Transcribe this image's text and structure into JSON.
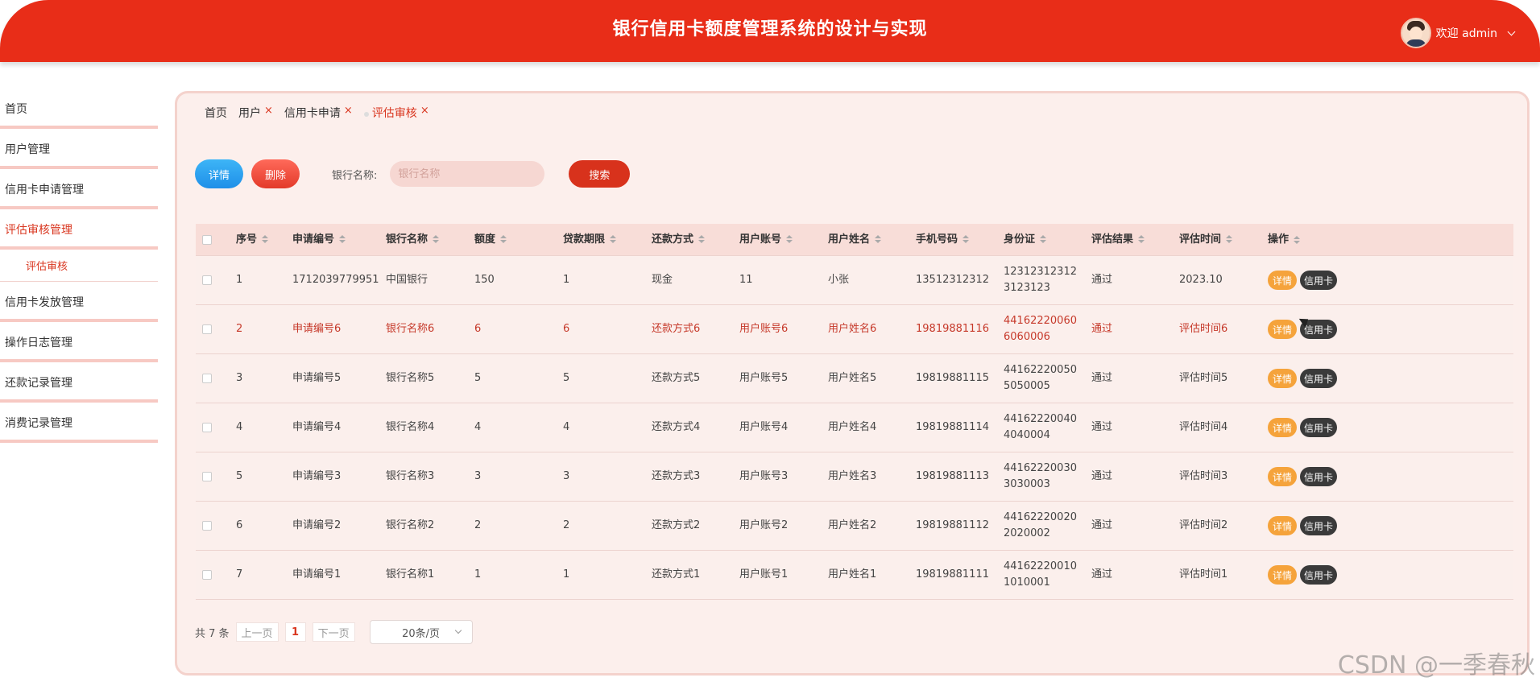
{
  "header": {
    "title": "银行信用卡额度管理系统的设计与实现",
    "welcome": "欢迎 admin"
  },
  "sidebar": {
    "items": [
      {
        "label": "首页"
      },
      {
        "label": "用户管理"
      },
      {
        "label": "信用卡申请管理"
      },
      {
        "label": "评估审核管理"
      },
      {
        "label": "信用卡发放管理"
      },
      {
        "label": "操作日志管理"
      },
      {
        "label": "还款记录管理"
      },
      {
        "label": "消费记录管理"
      }
    ],
    "sub_item": "评估审核"
  },
  "tabs": [
    {
      "label": "首页"
    },
    {
      "label": "用户",
      "close": "×"
    },
    {
      "label": "信用卡申请",
      "close": "×"
    },
    {
      "label": "评估审核",
      "close": "×"
    }
  ],
  "toolbar": {
    "detail": "详情",
    "delete": "删除",
    "bank_label": "银行名称:",
    "bank_placeholder": "银行名称",
    "search": "搜索"
  },
  "table": {
    "headers": [
      "序号",
      "申请编号",
      "银行名称",
      "额度",
      "贷款期限",
      "还款方式",
      "用户账号",
      "用户姓名",
      "手机号码",
      "身份证",
      "评估结果",
      "评估时间",
      "操作"
    ],
    "rows": [
      [
        "1",
        "1712039779951",
        "中国银行",
        "150",
        "1",
        "现金",
        "11",
        "小张",
        "13512312312",
        "123123123123123123",
        "通过",
        "2023.10"
      ],
      [
        "2",
        "申请编号6",
        "银行名称6",
        "6",
        "6",
        "还款方式6",
        "用户账号6",
        "用户姓名6",
        "19819881116",
        "441622200606060006",
        "通过",
        "评估时间6"
      ],
      [
        "3",
        "申请编号5",
        "银行名称5",
        "5",
        "5",
        "还款方式5",
        "用户账号5",
        "用户姓名5",
        "19819881115",
        "441622200505050005",
        "通过",
        "评估时间5"
      ],
      [
        "4",
        "申请编号4",
        "银行名称4",
        "4",
        "4",
        "还款方式4",
        "用户账号4",
        "用户姓名4",
        "19819881114",
        "441622200404040004",
        "通过",
        "评估时间4"
      ],
      [
        "5",
        "申请编号3",
        "银行名称3",
        "3",
        "3",
        "还款方式3",
        "用户账号3",
        "用户姓名3",
        "19819881113",
        "441622200303030003",
        "通过",
        "评估时间3"
      ],
      [
        "6",
        "申请编号2",
        "银行名称2",
        "2",
        "2",
        "还款方式2",
        "用户账号2",
        "用户姓名2",
        "19819881112",
        "441622200202020002",
        "通过",
        "评估时间2"
      ],
      [
        "7",
        "申请编号1",
        "银行名称1",
        "1",
        "1",
        "还款方式1",
        "用户账号1",
        "用户姓名1",
        "19819881111",
        "441622200101010001",
        "通过",
        "评估时间1"
      ]
    ],
    "action_detail": "详情",
    "action_card": "信用卡"
  },
  "pager": {
    "total": "共 7 条",
    "prev": "上一页",
    "page": "1",
    "next": "下一页",
    "size": "20条/页"
  },
  "watermark": "CSDN @一季春秋"
}
